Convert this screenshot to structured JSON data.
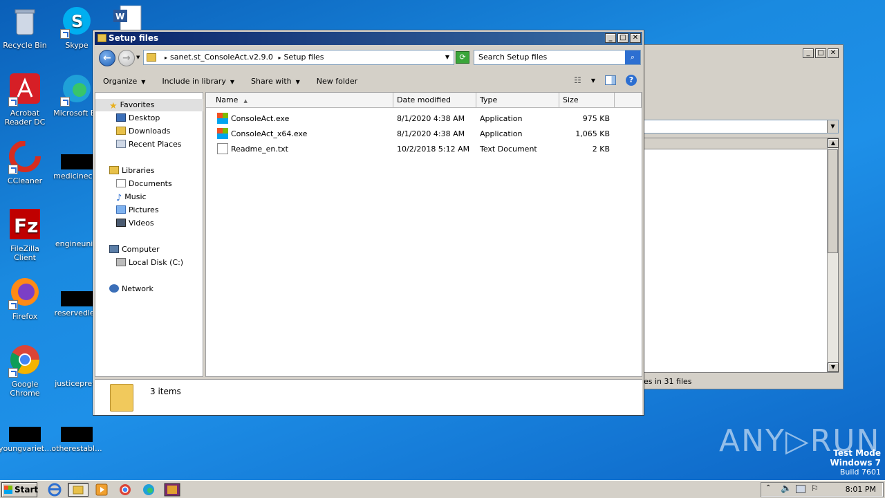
{
  "desktop": {
    "icons": [
      {
        "label": "Recycle Bin"
      },
      {
        "label": "Skype"
      },
      {
        "label": "Acrobat Reader DC"
      },
      {
        "label": "Microsoft Ed"
      },
      {
        "label": "CCleaner"
      },
      {
        "label": "medicinecer"
      },
      {
        "label": "FileZilla Client"
      },
      {
        "label": "engineunit."
      },
      {
        "label": "Firefox"
      },
      {
        "label": "reservedlea"
      },
      {
        "label": "Google Chrome"
      },
      {
        "label": "justiceprevi"
      },
      {
        "label": "youngvariet..."
      },
      {
        "label": "otherestabl..."
      }
    ]
  },
  "bg_window": {
    "status_text": "es in 31 files"
  },
  "explorer": {
    "title": "Setup files",
    "address": {
      "path": [
        "sanet.st_ConsoleAct.v2.9.0",
        "Setup files"
      ],
      "separator": "▸"
    },
    "search_placeholder": "Search Setup files",
    "toolbar": {
      "organize": "Organize",
      "include_in_library": "Include in library",
      "share_with": "Share with",
      "new_folder": "New folder"
    },
    "nav": {
      "favorites": "Favorites",
      "desktop": "Desktop",
      "downloads": "Downloads",
      "recent_places": "Recent Places",
      "libraries": "Libraries",
      "documents": "Documents",
      "music": "Music",
      "pictures": "Pictures",
      "videos": "Videos",
      "computer": "Computer",
      "local_disk": "Local Disk (C:)",
      "network": "Network"
    },
    "columns": {
      "name": "Name",
      "date_modified": "Date modified",
      "type": "Type",
      "size": "Size"
    },
    "files": [
      {
        "name": "ConsoleAct.exe",
        "date": "8/1/2020 4:38 AM",
        "type": "Application",
        "size": "975 KB",
        "icon": "exe-icon"
      },
      {
        "name": "ConsoleAct_x64.exe",
        "date": "8/1/2020 4:38 AM",
        "type": "Application",
        "size": "1,065 KB",
        "icon": "exe-icon"
      },
      {
        "name": "Readme_en.txt",
        "date": "10/2/2018 5:12 AM",
        "type": "Text Document",
        "size": "2 KB",
        "icon": "text-file-icon"
      }
    ],
    "status": "3 items"
  },
  "watermark": {
    "brand": "ANY▷RUN",
    "test_mode": "Test Mode",
    "os": "Windows 7",
    "build": "Build 7601"
  },
  "taskbar": {
    "start": "Start",
    "clock": "8:01 PM"
  },
  "colors": {
    "desktop_blue": "#1a8ae0",
    "titlebar": "#0a246a",
    "chrome": "#d4d0c8"
  }
}
